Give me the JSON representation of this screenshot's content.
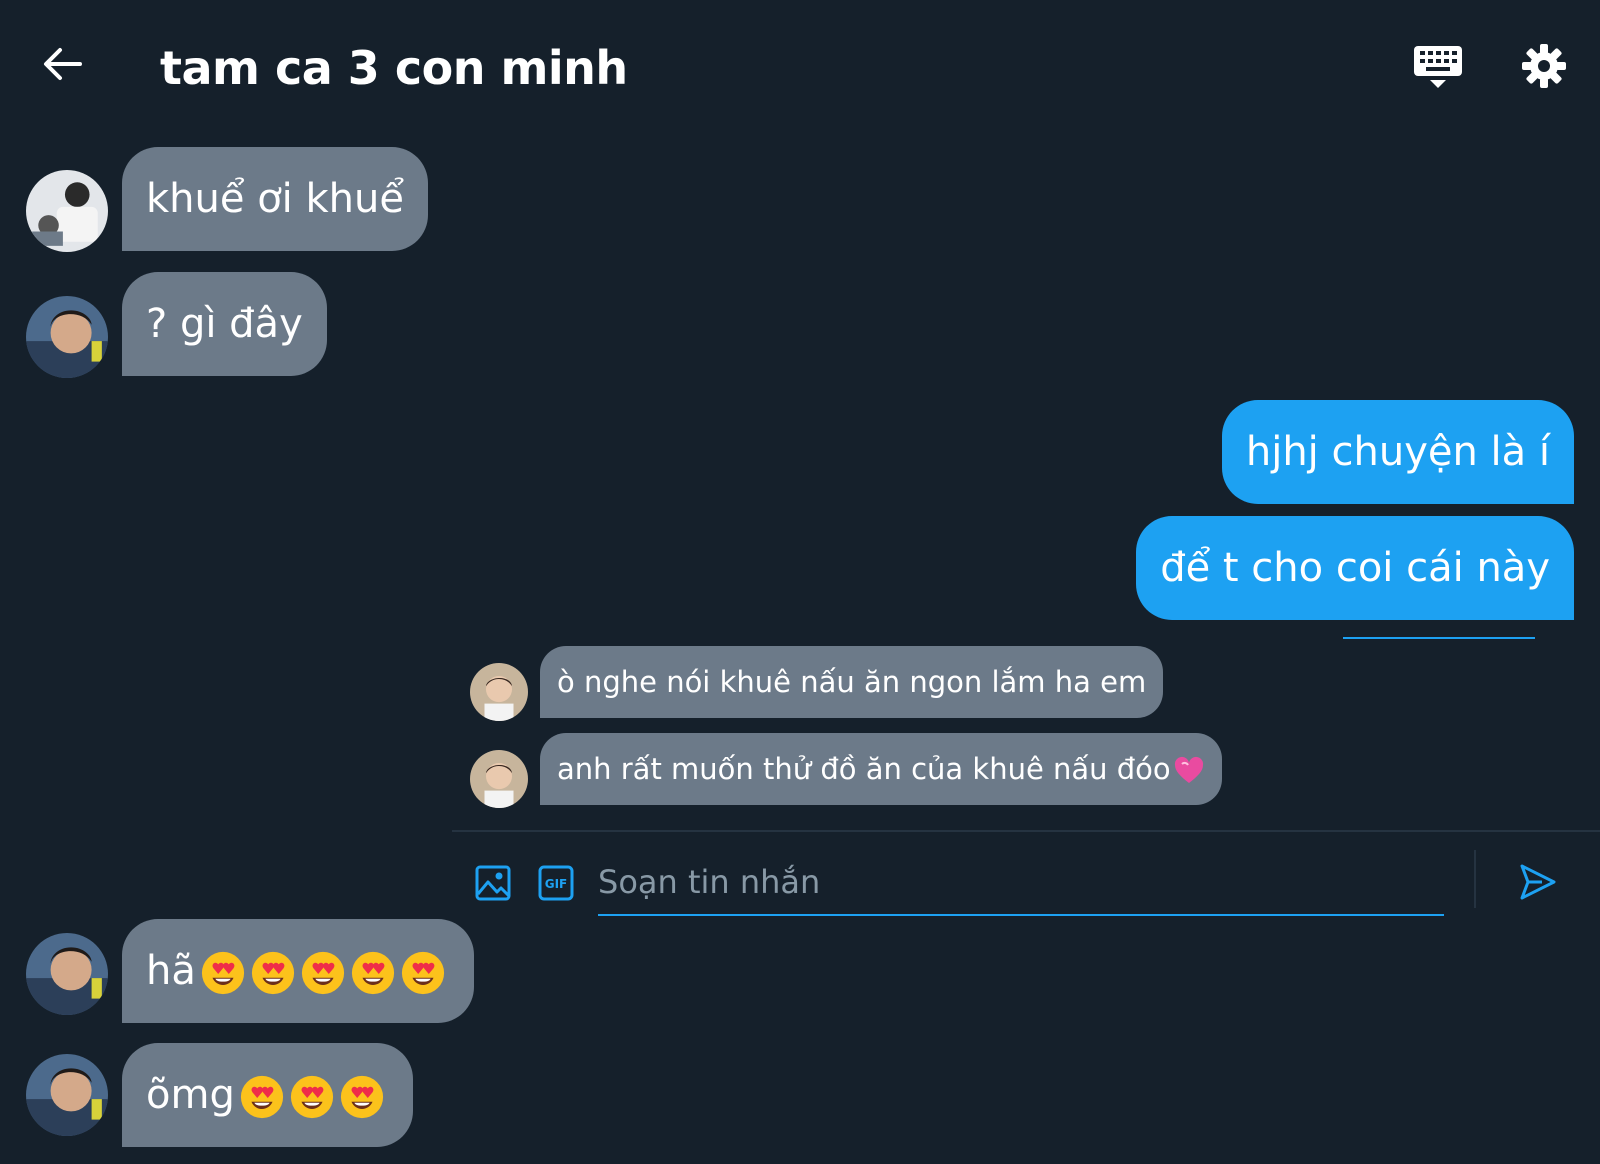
{
  "header": {
    "title": "tam ca 3 con minh"
  },
  "messages": [
    {
      "text": "khuể ơi khuể"
    },
    {
      "text": "? gì đây"
    },
    {
      "text": "hjhj chuyện là í"
    },
    {
      "text": "để t cho coi cái này"
    },
    {
      "text": "ò nghe nói khuê nấu ăn ngon lắm ha em"
    },
    {
      "text": "anh rất muốn thử đồ ăn của khuê nấu đóo"
    },
    {
      "text": "hã"
    },
    {
      "text": "õmg"
    }
  ],
  "composer": {
    "placeholder": "Soạn tin nhắn"
  },
  "colors": {
    "background": "#15202b",
    "incoming_bubble": "#6c7a89",
    "outgoing_bubble": "#1da1f2",
    "accent": "#1da1f2"
  },
  "icons": [
    "back-arrow-icon",
    "keyboard-icon",
    "gear-icon",
    "image-icon",
    "gif-icon",
    "send-icon",
    "heart-eyes-emoji",
    "pink-heart-emoji"
  ]
}
